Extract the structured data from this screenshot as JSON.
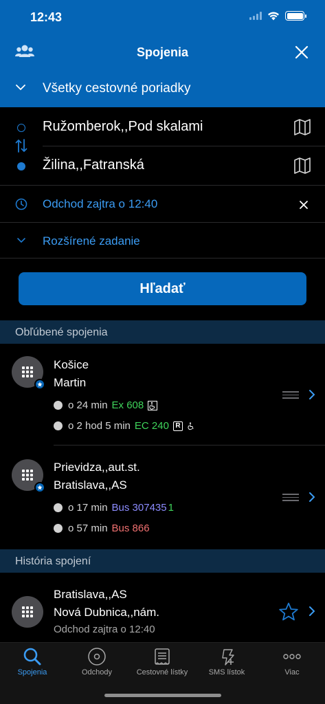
{
  "status": {
    "time": "12:43"
  },
  "nav": {
    "title": "Spojenia"
  },
  "timetables": {
    "label": "Všetky cestovné poriadky"
  },
  "form": {
    "from": "Ružomberok,,Pod skalami",
    "to": "Žilina,,Fatranská",
    "departure": "Odchod zajtra o 12:40",
    "advanced": "Rozšírené zadanie",
    "search_label": "Hľadať"
  },
  "favorites": {
    "header": "Obľúbené spojenia",
    "items": [
      {
        "from": "Košice",
        "to": "Martin",
        "trips": [
          {
            "time": "o 24 min",
            "train": "Ex 608",
            "extras": [
              "wheelchair"
            ]
          },
          {
            "time": "o 2 hod 5 min",
            "train": "EC 240",
            "extras": [
              "reservation",
              "wheelchair"
            ]
          }
        ]
      },
      {
        "from": "Prievidza,,aut.st.",
        "to": "Bratislava,,AS",
        "trips": [
          {
            "time": "o 17 min",
            "train": "Bus 307435",
            "platform": "1"
          },
          {
            "time": "o 57 min",
            "train": "Bus 866"
          }
        ]
      }
    ]
  },
  "history": {
    "header": "História spojení",
    "items": [
      {
        "from": "Bratislava,,AS",
        "to": "Nová Dubnica,,nám.",
        "departure": "Odchod zajtra o 12:40"
      }
    ]
  },
  "tabs": [
    {
      "label": "Spojenia",
      "icon": "search-icon",
      "active": true
    },
    {
      "label": "Odchody",
      "icon": "departures-icon",
      "active": false
    },
    {
      "label": "Cestovné lístky",
      "icon": "ticket-icon",
      "active": false
    },
    {
      "label": "SMS lístok",
      "icon": "sms-ticket-icon",
      "active": false
    },
    {
      "label": "Viac",
      "icon": "more-icon",
      "active": false
    }
  ],
  "colors": {
    "brand_blue": "#0565b6",
    "link_blue": "#3b9cf3",
    "train_green": "#3fd45b",
    "bus_purple": "#8c8cff",
    "bus_red": "#f07070"
  }
}
